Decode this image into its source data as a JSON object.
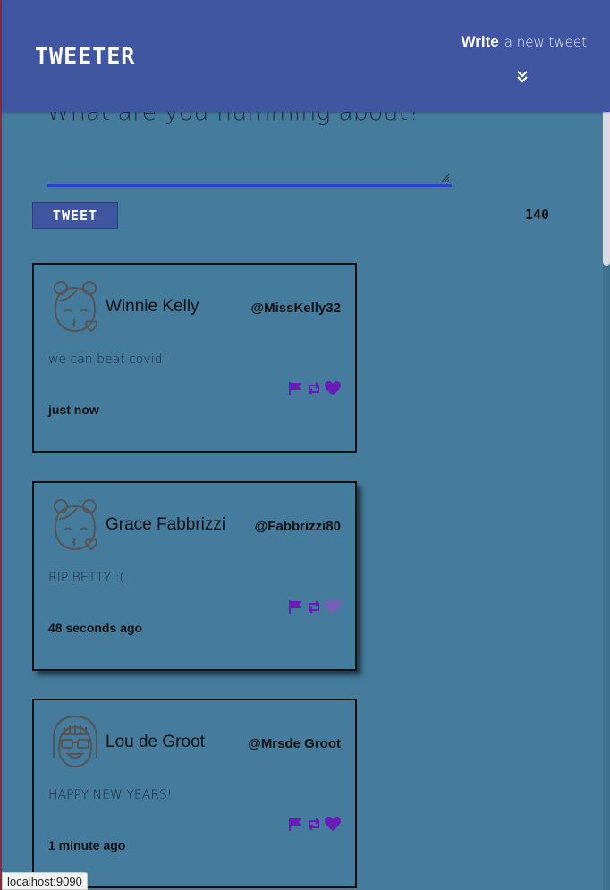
{
  "nav": {
    "brand": "TWEETER",
    "write_bold": "Write",
    "write_rest": "a new tweet",
    "chevron_icon": "double-chevron-down-icon"
  },
  "compose": {
    "placeholder": "What are you humming about?",
    "button_label": "TWEET",
    "counter": "140"
  },
  "colors": {
    "background": "#457b9d",
    "nav": "#4056a1",
    "icon_accent": "#6a1bb8"
  },
  "tweets": [
    {
      "name": "Winnie Kelly",
      "handle": "@MissKelly32",
      "text": "we can beat covid!",
      "time": "just now",
      "avatar_icon": "girl-kiss-icon"
    },
    {
      "name": "Grace Fabbrizzi",
      "handle": "@Fabbrizzi80",
      "text": "RIP BETTY :(",
      "time": "48 seconds ago",
      "avatar_icon": "girl-kiss-icon"
    },
    {
      "name": "Lou de Groot",
      "handle": "@Mrsde Groot",
      "text": "HAPPY NEW YEARS!",
      "time": "1 minute ago",
      "avatar_icon": "woman-glasses-icon"
    }
  ],
  "status": {
    "url": "localhost:9090"
  }
}
